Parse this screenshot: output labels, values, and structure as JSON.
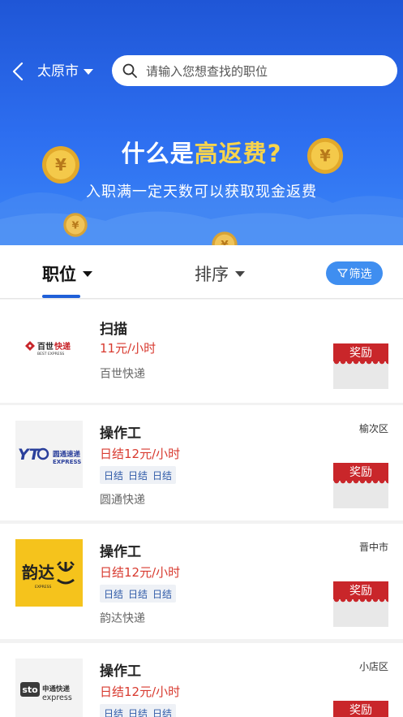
{
  "header": {
    "city": "太原市",
    "search_placeholder": "请输入您想查找的职位"
  },
  "banner": {
    "headline_prefix": "什么是",
    "headline_highlight": "高返费?",
    "subtitle": "入职满一定天数可以获取现金返费"
  },
  "tabs": {
    "position": "职位",
    "sort": "排序",
    "filter": "筛选"
  },
  "jobs": [
    {
      "title": "扫描",
      "pay": "11元/小时",
      "tags": [],
      "company": "百世快递",
      "district": "",
      "reward": "奖励",
      "logo_text": "百世快递",
      "logo_sub": "BEST EXPRESS"
    },
    {
      "title": "操作工",
      "pay": "日结12元/小时",
      "tags": [
        "日结",
        "日结",
        "日结"
      ],
      "company": "圆通快递",
      "district": "榆次区",
      "reward": "奖励",
      "logo_text": "圆通速递",
      "logo_sub": "EXPRESS",
      "logo_mark": "YTO"
    },
    {
      "title": "操作工",
      "pay": "日结12元/小时",
      "tags": [
        "日结",
        "日结",
        "日结"
      ],
      "company": "韵达快递",
      "district": "晋中市",
      "reward": "奖励",
      "logo_text": "韵达",
      "logo_sub": "EXPRESS"
    },
    {
      "title": "操作工",
      "pay": "日结12元/小时",
      "tags": [
        "日结",
        "日结",
        "日结"
      ],
      "company": "",
      "district": "小店区",
      "reward": "奖励",
      "logo_text": "申通快递",
      "logo_sub": "express",
      "logo_mark": "sto"
    }
  ],
  "colors": {
    "banner_blue": "#1f56d6",
    "highlight_yellow": "#f7d44c",
    "pay_red": "#d83a2f",
    "reward_red": "#c9262a",
    "filter_blue": "#3f8ef0",
    "tab_underline": "#1f5fd8"
  },
  "icons": {
    "back": "chevron-left-icon",
    "city_caret": "caret-down-icon",
    "search": "search-icon",
    "filter": "funnel-icon",
    "coins": "yuan-coin-icon"
  }
}
